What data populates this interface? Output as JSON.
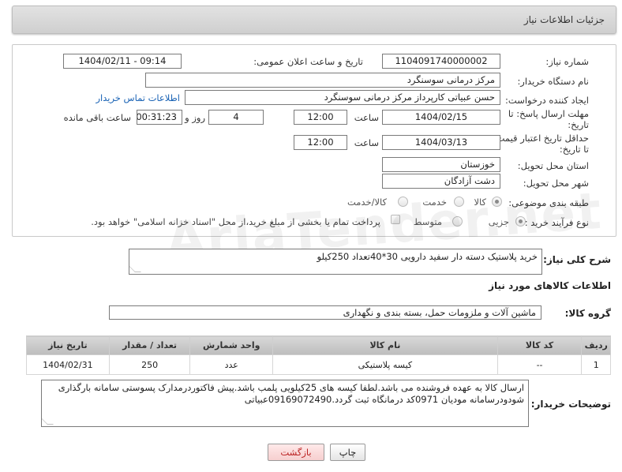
{
  "header": {
    "title": "جزئیات اطلاعات نیاز"
  },
  "form": {
    "need_number_label": "شماره نیاز:",
    "need_number": "1104091740000002",
    "announce_label": "تاریخ و ساعت اعلان عمومی:",
    "announce_value": "1404/02/11 - 09:14",
    "buyer_org_label": "نام دستگاه خریدار:",
    "buyer_org": "مرکز درمانی سوسنگرد",
    "creator_label": "ایجاد کننده درخواست:",
    "creator": "حسن عبیاتی کارپرداز مرکز درمانی سوسنگرد",
    "contact_link": "اطلاعات تماس خریدار",
    "deadline_label_1": "مهلت ارسال پاسخ: تا",
    "deadline_label_2": "تاریخ:",
    "deadline_date": "1404/02/15",
    "time_label": "ساعت",
    "deadline_time": "12:00",
    "days_value": "4",
    "days_label": "روز و",
    "remaining_time": "00:31:23",
    "remaining_label": "ساعت باقی مانده",
    "validity_label_1": "حداقل تاریخ اعتبار قیمت:",
    "validity_label_2": "تا تاریخ:",
    "validity_date": "1404/03/13",
    "validity_time": "12:00",
    "province_label": "استان محل تحویل:",
    "province": "خوزستان",
    "city_label": "شهر محل تحویل:",
    "city": "دشت آزادگان",
    "category_label": "طبقه بندی موضوعی:",
    "category_options": [
      "کالا",
      "خدمت",
      "کالا/خدمت"
    ],
    "category_selected": "کالا",
    "process_label": "نوع فرآیند خرید :",
    "process_options": [
      "جزیی",
      "متوسط"
    ],
    "process_selected": "جزیی",
    "payment_note": "پرداخت تمام یا بخشی از مبلغ خرید،از محل \"اسناد خزانه اسلامی\" خواهد بود."
  },
  "description": {
    "label": "شرح کلی نیاز:",
    "text": "خرید پلاستیک دسته دار سفید دارویی 30*40تعداد 250کیلو"
  },
  "goods": {
    "section_title": "اطلاعات کالاهای مورد نیاز",
    "group_label": "گروه کالا:",
    "group_value": "ماشین آلات و ملزومات حمل، بسته بندی و نگهداری",
    "columns": [
      "ردیف",
      "کد کالا",
      "نام کالا",
      "واحد شمارش",
      "تعداد / مقدار",
      "تاریخ نیاز"
    ],
    "rows": [
      {
        "row": "1",
        "code": "--",
        "name": "کیسه پلاستیکی",
        "unit": "عدد",
        "qty": "250",
        "date": "1404/02/31"
      }
    ]
  },
  "buyer_notes": {
    "label": "توضیحات خریدار:",
    "text": "ارسال کالا به عهده فروشنده می باشد.لطفا کیسه های 25کیلویی پلمب باشد.پیش فاکتوردرمدارک پسوستی سامانه بارگذاری شودودرسامانه مودیان 0971کد درمانگاه ثبت گردد.09169072490عبیاتی"
  },
  "buttons": {
    "print": "چاپ",
    "back": "بازگشت"
  }
}
